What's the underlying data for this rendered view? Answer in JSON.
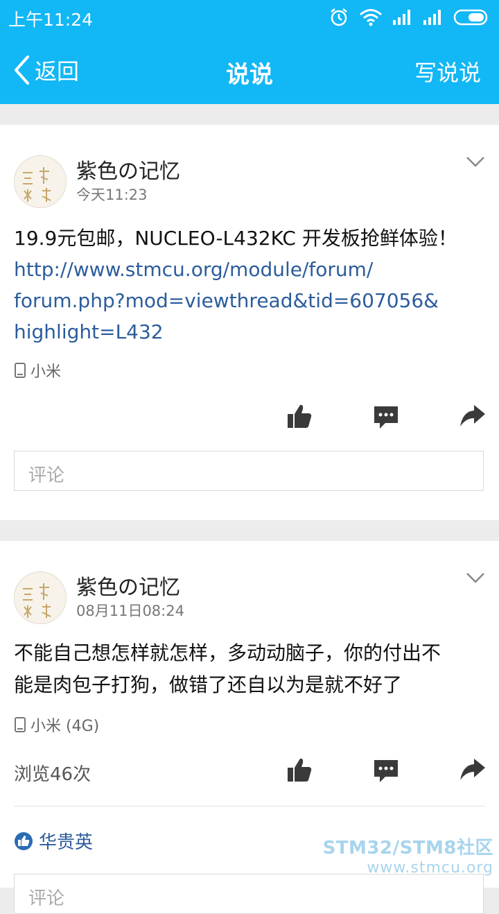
{
  "status_bar": {
    "time": "上午11:24"
  },
  "nav": {
    "back_label": "返回",
    "title": "说说",
    "write_label": "写说说"
  },
  "posts": [
    {
      "author": "紫色の记忆",
      "time": "今天11:23",
      "text": "19.9元包邮，NUCLEO-L432KC 开发板抢鲜体验！",
      "link_lines": [
        "http://www.stmcu.org/module/forum/",
        "forum.php?mod=viewthread&tid=607056&",
        "highlight=L432"
      ],
      "device": "小米",
      "comment_placeholder": "评论"
    },
    {
      "author": "紫色の记忆",
      "time": "08月11日08:24",
      "text_lines": [
        "不能自己想怎样就怎样，多动动脑子，你的付出不",
        "能是肉包子打狗，做错了还自以为是就不好了"
      ],
      "device": "小米 (4G)",
      "views": "浏览46次",
      "liker": "华贵英",
      "comment_placeholder": "评论"
    }
  ],
  "watermark": {
    "line1": "STM32/STM8社区",
    "line2": "www.stmcu.org"
  },
  "colors": {
    "accent": "#12b7f5",
    "link": "#2b5c9c",
    "icon": "#3a3a3a"
  },
  "icons": [
    "alarm-icon",
    "wifi-icon",
    "signal-icon",
    "battery-icon",
    "chevron-down-icon",
    "phone-icon",
    "thumb-up-icon",
    "comment-icon",
    "share-icon"
  ]
}
